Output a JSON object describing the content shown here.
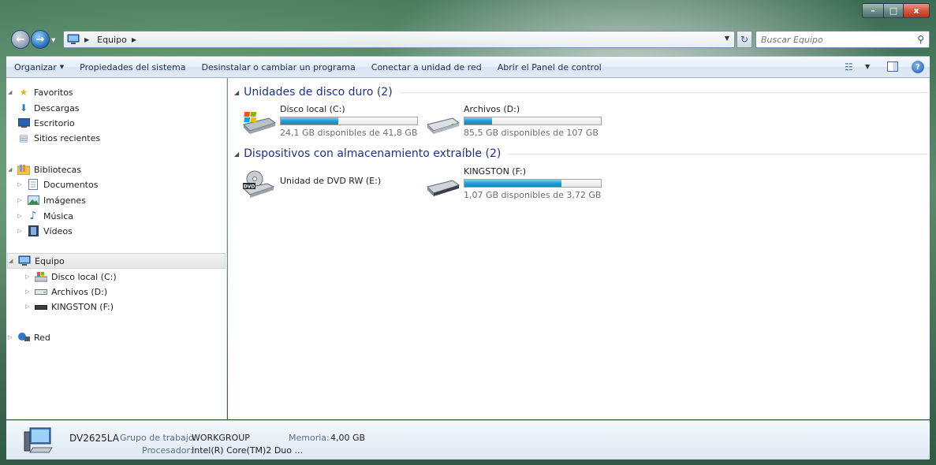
{
  "window": {
    "minimize_glyph": "–",
    "maximize_glyph": "□",
    "close_glyph": "x"
  },
  "navigation": {
    "breadcrumb": [
      "Equipo"
    ],
    "search_placeholder": "Buscar Equipo"
  },
  "toolbar": {
    "organize_label": "Organizar",
    "items": [
      "Propiedades del sistema",
      "Desinstalar o cambiar un programa",
      "Conectar a unidad de red",
      "Abrir el Panel de control"
    ],
    "help_glyph": "?"
  },
  "sidebar": {
    "favorites": {
      "label": "Favoritos",
      "items": [
        "Descargas",
        "Escritorio",
        "Sitios recientes"
      ]
    },
    "libraries": {
      "label": "Bibliotecas",
      "items": [
        "Documentos",
        "Imágenes",
        "Música",
        "Vídeos"
      ]
    },
    "computer": {
      "label": "Equipo",
      "items": [
        "Disco local (C:)",
        "Archivos (D:)",
        "KINGSTON (F:)"
      ]
    },
    "network": {
      "label": "Red"
    }
  },
  "main": {
    "hard_drives": {
      "header": "Unidades de disco duro (2)",
      "drives": [
        {
          "name": "Disco local (C:)",
          "free_text": "24,1 GB disponibles de 41,8 GB",
          "used_fraction": 0.42
        },
        {
          "name": "Archivos (D:)",
          "free_text": "85,5 GB disponibles de 107 GB",
          "used_fraction": 0.2
        }
      ]
    },
    "removable": {
      "header": "Dispositivos con almacenamiento extraíble (2)",
      "dvd": {
        "name": "Unidad de DVD RW (E:)",
        "badge": "DVD"
      },
      "usb": {
        "name": "KINGSTON (F:)",
        "free_text": "1,07 GB disponibles de 3,72 GB",
        "used_fraction": 0.71
      }
    }
  },
  "details": {
    "computer_name": "DV2625LA",
    "workgroup_label": "Grupo de trabajo:",
    "workgroup_value": "WORKGROUP",
    "memory_label": "Memoria:",
    "memory_value": "4,00 GB",
    "processor_label": "Procesador:",
    "processor_value": "Intel(R) Core(TM)2 Duo ..."
  },
  "colors": {
    "bar_fill": "#26a0da",
    "group_header": "#1e3287",
    "close_button": "#d35a40"
  }
}
